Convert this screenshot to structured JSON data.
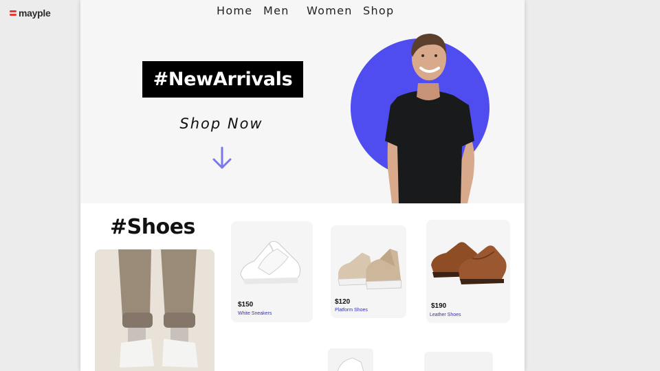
{
  "brand": {
    "name": "mayple"
  },
  "nav": {
    "items": [
      "Home",
      "Men",
      "Women",
      "Shop"
    ]
  },
  "hero": {
    "tag": "#NewArrivals",
    "cta": "Shop Now"
  },
  "section": {
    "title": "#Shoes"
  },
  "products": [
    {
      "price": "$150",
      "name": "White Sneakers"
    },
    {
      "price": "$120",
      "name": "Platform Shoes"
    },
    {
      "price": "$190",
      "name": "Leather Shoes"
    }
  ],
  "colors": {
    "accent": "#4f4df0",
    "brand": "#e53935",
    "tag_bg": "#000000",
    "link": "#3532a8"
  }
}
